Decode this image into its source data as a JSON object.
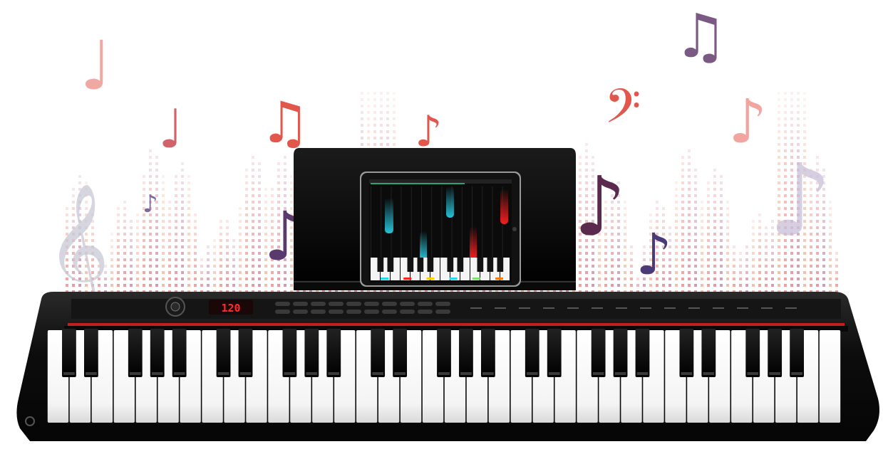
{
  "scene": {
    "description_free": true,
    "display": {
      "text": "120",
      "color": "#ff2a2a"
    },
    "colors": {
      "background": "#ffffff",
      "notes_warm": "#e2574c",
      "notes_cool": "#5a3a6e",
      "equalizer": "#e4756a",
      "keyboard_body": "#111111",
      "accent_red": "#c41e1e",
      "glow_cyan": "#28d6ee",
      "glow_red": "#ff2020"
    },
    "icons": [
      "treble-clef-icon",
      "bass-clef-icon",
      "eighth-note-icon",
      "beamed-notes-icon",
      "quarter-note-icon"
    ],
    "keyboard": {
      "white_keys": 36,
      "octaves": 5
    }
  }
}
